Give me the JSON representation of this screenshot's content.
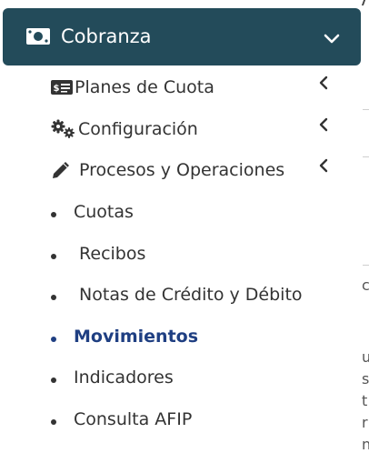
{
  "header": {
    "title": "Cobranza",
    "icon": "money-bill-icon",
    "expand_icon": "chevron-down-icon",
    "color": "#234b5a"
  },
  "submenus": [
    {
      "label": "Planes de Cuota",
      "icon": "dollar-card-icon",
      "arrow": "chevron-left-icon"
    },
    {
      "label": "Configuración",
      "icon": "gears-icon",
      "arrow": "chevron-left-icon"
    },
    {
      "label": "Procesos y Operaciones",
      "icon": "pencil-icon",
      "arrow": "chevron-left-icon"
    }
  ],
  "items": [
    {
      "label": "Cuotas"
    },
    {
      "label": " Recibos"
    },
    {
      "label": " Notas de Crédito y Débito"
    },
    {
      "label": "Movimientos",
      "active": true
    },
    {
      "label": "Indicadores"
    },
    {
      "label": "Consulta AFIP"
    }
  ],
  "active_color": "#1f3f82"
}
